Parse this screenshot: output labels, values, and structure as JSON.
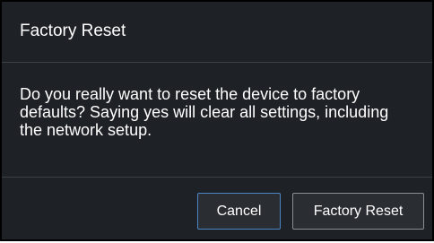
{
  "dialog": {
    "title": "Factory Reset",
    "message": "Do you really want to reset the device to factory defaults? Saying yes will clear all settings, including the network setup.",
    "cancel_label": "Cancel",
    "confirm_label": "Factory Reset"
  },
  "colors": {
    "background": "#1e2125",
    "text": "#ffffff",
    "focus_border": "#4a86c5",
    "divider": "#3c4147"
  }
}
